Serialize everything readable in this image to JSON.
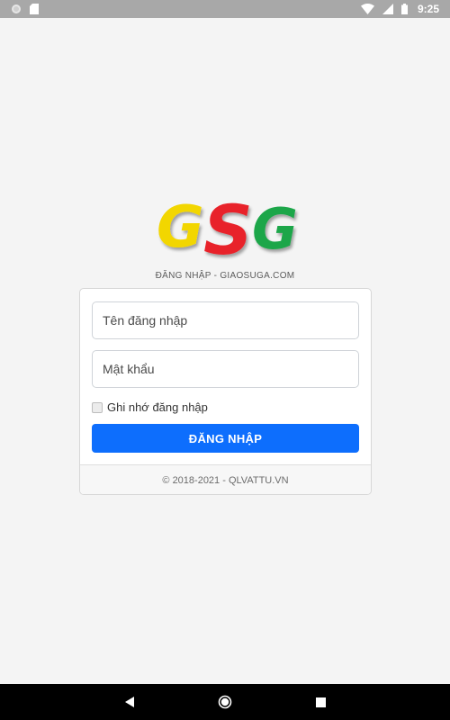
{
  "status_bar": {
    "time": "9:25",
    "icons": [
      "circle-notification-icon",
      "sd-card-icon",
      "wifi-icon",
      "signal-icon",
      "battery-icon"
    ],
    "background_color": "#a8a8a8"
  },
  "logo": {
    "letters": [
      "G",
      "S",
      "G"
    ],
    "colors": [
      "#f2d600",
      "#e8232a",
      "#1da64a"
    ]
  },
  "subtitle": "ĐĂNG NHẬP - GIAOSUGA.COM",
  "login_form": {
    "username_placeholder": "Tên đăng nhập",
    "username_value": "",
    "password_placeholder": "Mật khẩu",
    "password_value": "",
    "remember_label": "Ghi nhớ đăng nhập",
    "remember_checked": false,
    "submit_label": "ĐĂNG NHẬP",
    "submit_color": "#0d6efd"
  },
  "footer": {
    "copyright": "© 2018-2021 - QLVATTU.VN"
  },
  "nav_bar": {
    "buttons": [
      "back-icon",
      "home-icon",
      "recent-apps-icon"
    ]
  }
}
